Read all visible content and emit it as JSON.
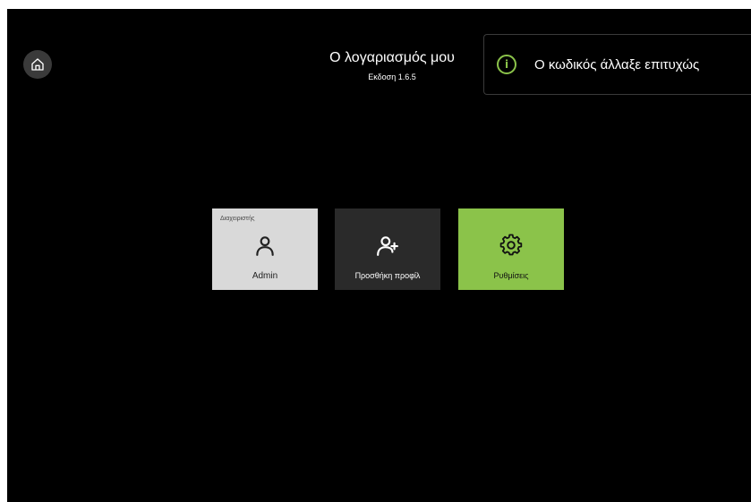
{
  "header": {
    "home_icon": "home-icon",
    "title": "Ο λογαριασμός μου",
    "version": "Εκδοση 1.6.5"
  },
  "toast": {
    "icon": "info-icon",
    "icon_glyph": "i",
    "message": "Ο κωδικός άλλαξε επιτυχώς",
    "accent_color": "#8bc34a"
  },
  "tiles": [
    {
      "role": "Διαχειριστής",
      "label": "Admin",
      "icon": "user-icon",
      "color": "#d9d9d9"
    },
    {
      "label": "Προσθήκη προφίλ",
      "icon": "add-user-icon",
      "color": "#2a2a2a"
    },
    {
      "label": "Ρυθμίσεις",
      "icon": "gear-icon",
      "color": "#8bc34a"
    }
  ]
}
